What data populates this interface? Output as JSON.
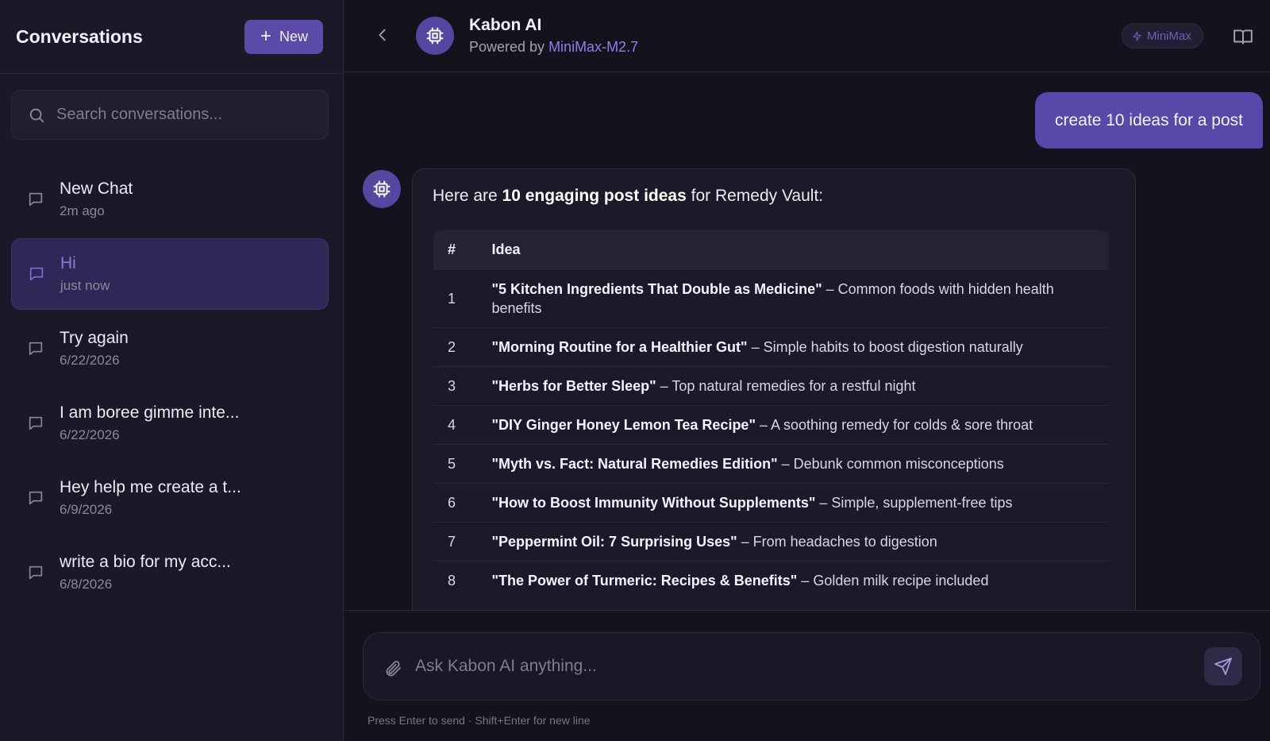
{
  "sidebar": {
    "title": "Conversations",
    "new_label": "New",
    "search_placeholder": "Search conversations...",
    "conversations": [
      {
        "title": "New Chat",
        "time": "2m ago",
        "active": false
      },
      {
        "title": "Hi",
        "time": "just now",
        "active": true
      },
      {
        "title": "Try again",
        "time": "6/22/2026",
        "active": false
      },
      {
        "title": "I am boree gimme inte...",
        "time": "6/22/2026",
        "active": false
      },
      {
        "title": "Hey help me create a t...",
        "time": "6/9/2026",
        "active": false
      },
      {
        "title": "write a bio for my acc...",
        "time": "6/8/2026",
        "active": false
      }
    ]
  },
  "header": {
    "title": "Kabon AI",
    "subtitle_prefix": "Powered by ",
    "model": "MiniMax-M2.7",
    "badge": "MiniMax"
  },
  "chat": {
    "user_message": "create 10 ideas for a post",
    "ai_intro_prefix": "Here are ",
    "ai_intro_bold": "10 engaging post ideas",
    "ai_intro_suffix": " for Remedy Vault:",
    "table_headers": {
      "num": "#",
      "idea": "Idea"
    },
    "ideas": [
      {
        "num": "1",
        "title": "\"5 Kitchen Ingredients That Double as Medicine\"",
        "desc": " – Common foods with hidden health benefits"
      },
      {
        "num": "2",
        "title": "\"Morning Routine for a Healthier Gut\"",
        "desc": " – Simple habits to boost digestion naturally"
      },
      {
        "num": "3",
        "title": "\"Herbs for Better Sleep\"",
        "desc": " – Top natural remedies for a restful night"
      },
      {
        "num": "4",
        "title": "\"DIY Ginger Honey Lemon Tea Recipe\"",
        "desc": " – A soothing remedy for colds & sore throat"
      },
      {
        "num": "5",
        "title": "\"Myth vs. Fact: Natural Remedies Edition\"",
        "desc": " – Debunk common misconceptions"
      },
      {
        "num": "6",
        "title": "\"How to Boost Immunity Without Supplements\"",
        "desc": " – Simple, supplement-free tips"
      },
      {
        "num": "7",
        "title": "\"Peppermint Oil: 7 Surprising Uses\"",
        "desc": " – From headaches to digestion"
      },
      {
        "num": "8",
        "title": "\"The Power of Turmeric: Recipes & Benefits\"",
        "desc": " – Golden milk recipe included"
      }
    ]
  },
  "composer": {
    "placeholder": "Ask Kabon AI anything...",
    "hint": "Press Enter to send · Shift+Enter for new line"
  },
  "icons": {
    "search": "search-icon",
    "chat_bubble": "chat-bubble-icon",
    "back": "chevron-left-icon",
    "bot": "chip-icon",
    "bolt": "lightning-icon",
    "book": "book-icon",
    "attach": "paperclip-icon",
    "send": "send-icon"
  },
  "colors": {
    "accent": "#5b4aa8",
    "background": "#14121d",
    "sidebar": "#1b1928",
    "model_link": "#8e80e8"
  }
}
